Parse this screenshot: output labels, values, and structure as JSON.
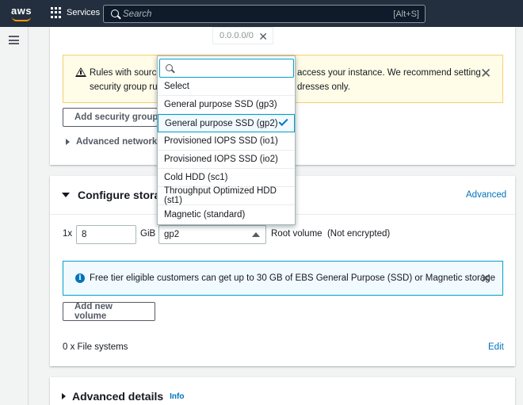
{
  "topbar": {
    "logo": "aws",
    "services_label": "Services",
    "search_placeholder": "Search",
    "search_shortcut": "[Alt+S]"
  },
  "network": {
    "ip_chip": "0.0.0.0/0",
    "warning_text": "Rules with source of 0.0.0.0/0 allow all IP addresses to access your instance. We recommend setting security group rules to allow access from known IP addresses only.",
    "warning_line1_visible": "Rules with source",
    "warning_line1_right": "access your instance. We recommend setting",
    "warning_line2_visible": "security group rule",
    "warning_line2_right": "dresses only.",
    "add_rule_label": "Add security group r",
    "advanced_label": "Advanced network co"
  },
  "storage": {
    "title": "Configure storag",
    "advanced_link": "Advanced",
    "multiplier": "1x",
    "size_value": "8",
    "size_unit": "GiB",
    "volume_type": "gp2",
    "root_label": "Root volume  (Not encrypted)",
    "info_text": "Free tier eligible customers can get up to 30 GB of EBS General Purpose (SSD) or Magnetic storage",
    "add_volume_label": "Add new volume",
    "file_systems_label": "0 x File systems",
    "edit_link": "Edit"
  },
  "dropdown": {
    "search_value": "",
    "items": [
      {
        "label": "Select",
        "selected": false
      },
      {
        "label": "General purpose SSD (gp3)",
        "selected": false
      },
      {
        "label": "General purpose SSD (gp2)",
        "selected": true
      },
      {
        "label": "Provisioned IOPS SSD (io1)",
        "selected": false
      },
      {
        "label": "Provisioned IOPS SSD (io2)",
        "selected": false
      },
      {
        "label": "Cold HDD (sc1)",
        "selected": false
      },
      {
        "label": "Throughput Optimized HDD (st1)",
        "selected": false
      },
      {
        "label": "Magnetic (standard)",
        "selected": false
      }
    ]
  },
  "advanced_details": {
    "title": "Advanced details",
    "info_link": "Info"
  },
  "colors": {
    "topbar": "#232f3e",
    "accent": "#ff9900",
    "link": "#0073bb",
    "warning_bg": "#fffce7",
    "info_bg": "#f1faff"
  }
}
